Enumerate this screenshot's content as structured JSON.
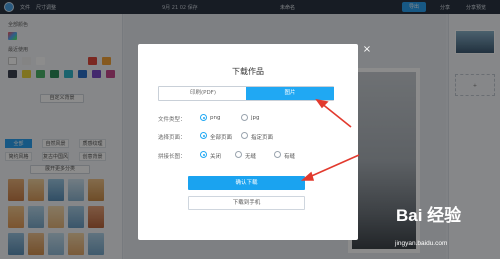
{
  "topbar": {
    "menu": [
      "文件",
      "尺寸调整"
    ],
    "center_status": "9月 21  02 保存",
    "doc_title": "未命名",
    "export": "导出",
    "right_items": [
      "分享",
      "分享预览"
    ]
  },
  "left_panel": {
    "section_colors": "全部颜色",
    "section_recent": "最近使用",
    "custom_bg_button": "自定义背景",
    "tabs_row1": [
      "全部",
      "自然风景",
      "质感纹理"
    ],
    "tabs_row2": [
      "简约风格",
      "复古中国风",
      "创意背景"
    ],
    "more_button": "展开更多分类"
  },
  "modal": {
    "title": "下载作品",
    "tabs": [
      "印刷(PDF)",
      "图片"
    ],
    "active_tab": "图片",
    "rows": [
      {
        "label": "文件类型：",
        "options": [
          "png",
          "jpg"
        ],
        "selected": "png"
      },
      {
        "label": "选择页面：",
        "options": [
          "全部页面",
          "指定页面"
        ],
        "selected": "全部页面"
      },
      {
        "label": "拼接长图：",
        "options": [
          "关闭",
          "无缝",
          "有缝"
        ],
        "selected": "关闭"
      }
    ],
    "confirm_button": "确认下载",
    "phone_button": "下载到手机",
    "close_icon": "×"
  },
  "watermark": {
    "brand": "Bai 经验",
    "url": "jingyan.baidu.com"
  },
  "colors": {
    "accent": "#20a8f3",
    "arrow": "#e23a2e"
  }
}
